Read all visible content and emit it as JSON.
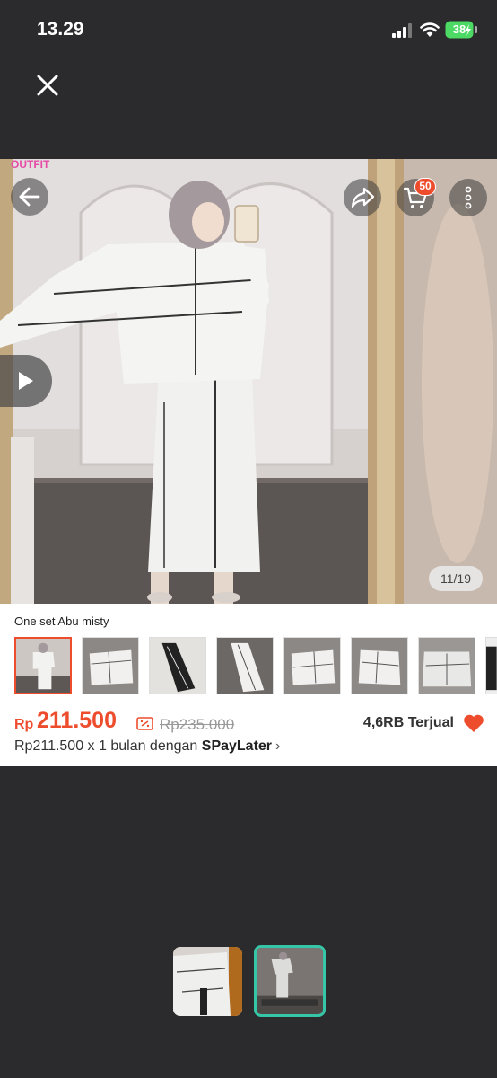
{
  "status_bar": {
    "time": "13.29",
    "battery": "38"
  },
  "viewer": {
    "brand_text": "OUTFIT",
    "cart_count": "50",
    "page_indicator": "11/19"
  },
  "product": {
    "variant_name": "One set Abu misty",
    "price_currency": "Rp",
    "price_value": "211.500",
    "original_price": "Rp235.000",
    "sold": "4,6RB Terjual",
    "paylater_prefix": "Rp211.500 x 1 bulan dengan ",
    "paylater_brand": "SPayLater",
    "paylater_chevron": "›"
  },
  "thumbnails": [
    "outfit-full",
    "top-flat",
    "skirt-black",
    "skirt-white",
    "top-flat",
    "top-flat",
    "top-gray",
    "partial"
  ],
  "colors": {
    "accent": "#ee4d2d",
    "strip_selected": "#35c6a8",
    "background": "#2b2b2d"
  }
}
